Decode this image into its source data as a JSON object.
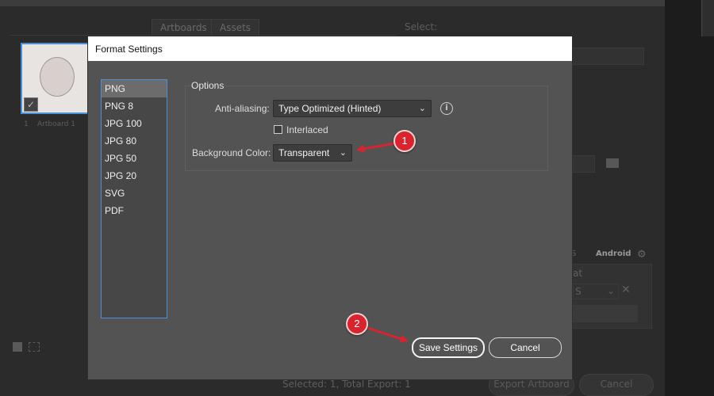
{
  "background": {
    "tabs": [
      "Artboards",
      "Assets"
    ],
    "select_label": "Select:",
    "artboard_index": "1",
    "artboard_name": "Artboard 1",
    "platform_ios": "S",
    "platform_android": "Android",
    "format_header": "at",
    "format_value": "S",
    "status_text": "Selected: 1, Total Export: 1",
    "export_button": "Export Artboard",
    "cancel_button": "Cancel"
  },
  "dialog": {
    "title": "Format Settings",
    "formats": [
      "PNG",
      "PNG 8",
      "JPG 100",
      "JPG 80",
      "JPG 50",
      "JPG 20",
      "SVG",
      "PDF"
    ],
    "selected_format": "PNG",
    "options_label": "Options",
    "anti_aliasing_label": "Anti-aliasing:",
    "anti_aliasing_value": "Type Optimized (Hinted)",
    "interlaced_label": "Interlaced",
    "interlaced_checked": false,
    "background_color_label": "Background Color:",
    "background_color_value": "Transparent",
    "save_button": "Save Settings",
    "cancel_button": "Cancel"
  },
  "annotations": [
    {
      "number": "1"
    },
    {
      "number": "2"
    }
  ],
  "colors": {
    "annotation_red": "#d7242f",
    "selection_blue": "#4a90d9",
    "dialog_bg": "#535353"
  }
}
